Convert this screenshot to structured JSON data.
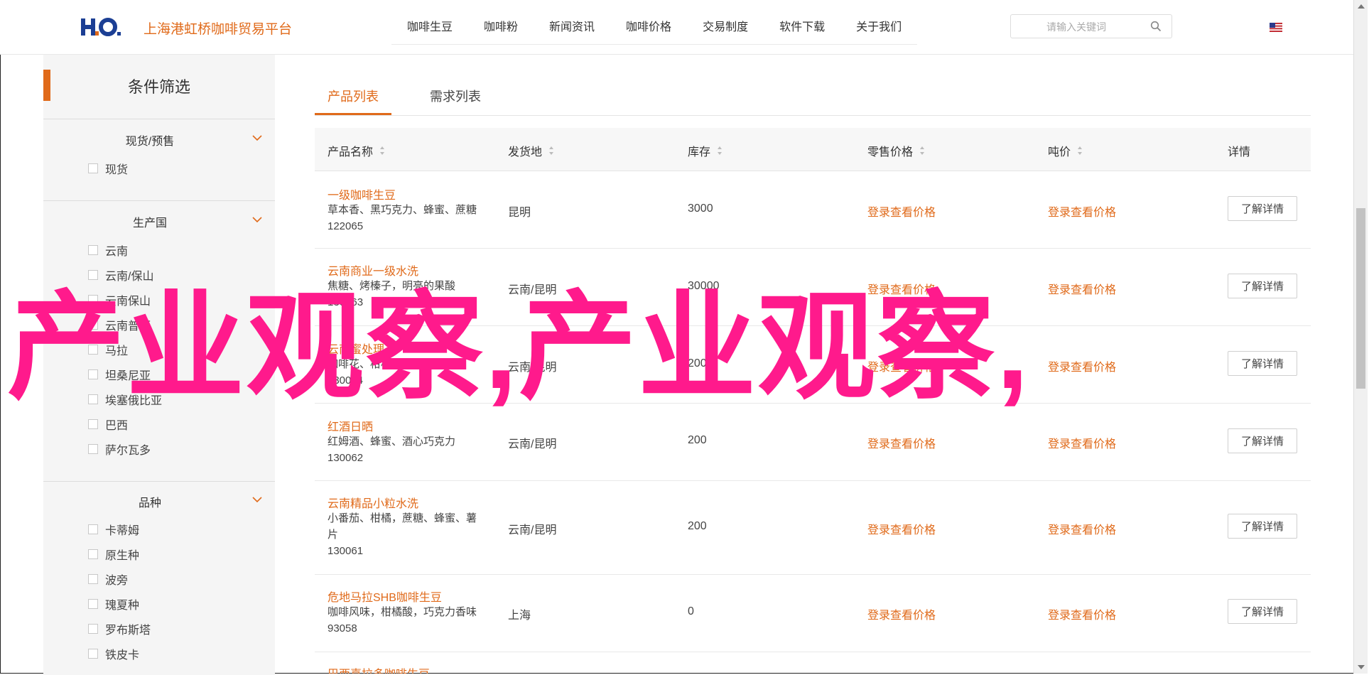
{
  "header": {
    "site_title": "上海港虹桥咖啡贸易平台",
    "nav": [
      "咖啡生豆",
      "咖啡粉",
      "新闻资讯",
      "咖啡价格",
      "交易制度",
      "软件下载",
      "关于我们"
    ],
    "search_placeholder": "请输入关键词",
    "accent_color": "#e06a1a"
  },
  "sidebar": {
    "title": "条件筛选",
    "groups": [
      {
        "label": "现货/预售",
        "options": [
          "现货"
        ]
      },
      {
        "label": "生产国",
        "options": [
          "云南",
          "云南/保山",
          "云南保山",
          "云南普洱",
          "马拉",
          "坦桑尼亚",
          "埃塞俄比亚",
          "巴西",
          "萨尔瓦多"
        ]
      },
      {
        "label": "品种",
        "options": [
          "卡蒂姆",
          "原生种",
          "波旁",
          "瑰夏种",
          "罗布斯塔",
          "铁皮卡"
        ]
      }
    ]
  },
  "tabs": [
    "产品列表",
    "需求列表"
  ],
  "table": {
    "headers": [
      "产品名称",
      "发货地",
      "库存",
      "零售价格",
      "吨价",
      "详情"
    ],
    "rows": [
      {
        "name": "一级咖啡生豆",
        "desc": "草本香、黑巧克力、蜂蜜、蔗糖",
        "code": "122065",
        "origin": "昆明",
        "stock": "3000",
        "retail": "登录查看价格",
        "ton": "登录查看价格",
        "btn": "了解详情"
      },
      {
        "name": "云南商业一级水洗",
        "desc": "焦糖、烤榛子，明亮的果酸",
        "code": "130063",
        "origin": "云南/昆明",
        "stock": "30000",
        "retail": "登录查看价格",
        "ton": "登录查看价格",
        "btn": "了解详情"
      },
      {
        "name": "云南蜜处理",
        "desc": "咖啡花、柑橘、黑糖",
        "code": "130064",
        "origin": "云南/昆明",
        "stock": "200",
        "retail": "登录查看价格",
        "ton": "登录查看价格",
        "btn": "了解详情"
      },
      {
        "name": "红酒日晒",
        "desc": "红姆酒、蜂蜜、酒心巧克力",
        "code": "130062",
        "origin": "云南/昆明",
        "stock": "200",
        "retail": "登录查看价格",
        "ton": "登录查看价格",
        "btn": "了解详情"
      },
      {
        "name": "云南精品小粒水洗",
        "desc": "小番茄、柑橘，蔗糖、蜂蜜、薯片",
        "code": "130061",
        "origin": "云南/昆明",
        "stock": "200",
        "retail": "登录查看价格",
        "ton": "登录查看价格",
        "btn": "了解详情"
      },
      {
        "name": "危地马拉SHB咖啡生豆",
        "desc": "咖啡风味，柑橘酸，巧克力香味",
        "code": "93058",
        "origin": "上海",
        "stock": "0",
        "retail": "登录查看价格",
        "ton": "登录查看价格",
        "btn": "了解详情"
      },
      {
        "name": "巴西喜拉多咖啡生豆",
        "desc": "",
        "code": "",
        "origin": "",
        "stock": "",
        "retail": "",
        "ton": "",
        "btn": ""
      }
    ]
  },
  "watermark": "产业观察,产业观察,"
}
